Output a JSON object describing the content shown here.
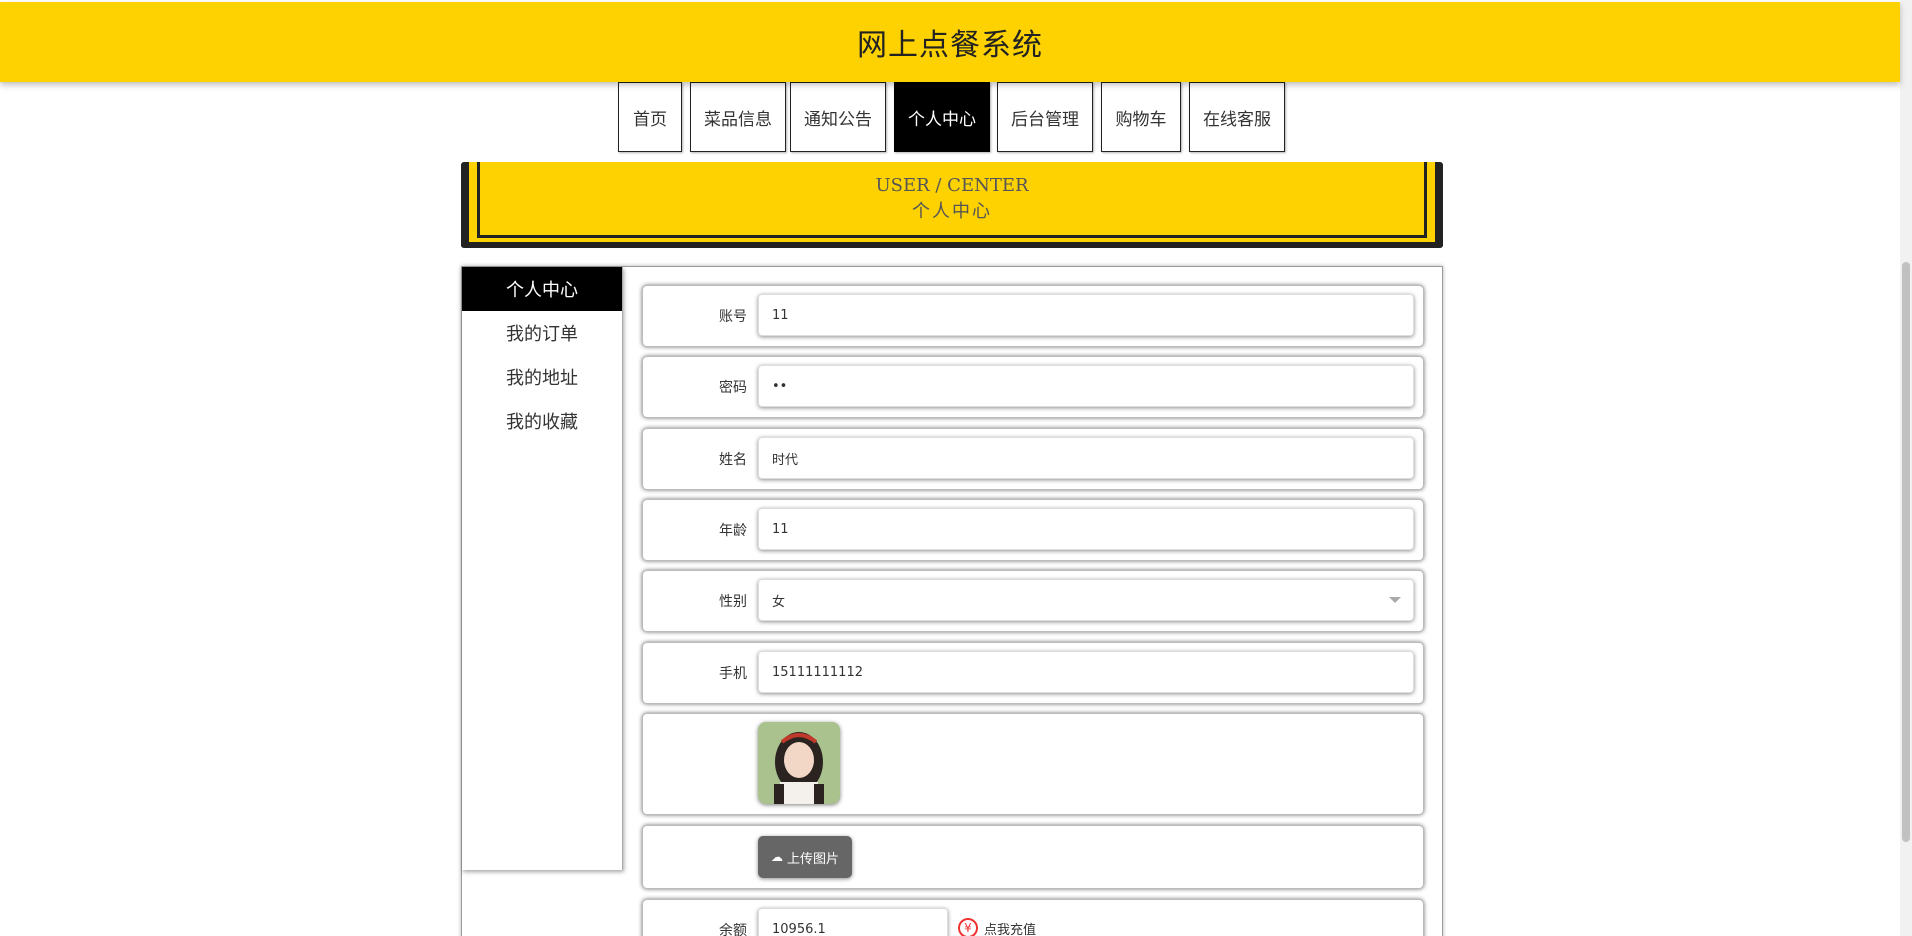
{
  "header": {
    "title": "网上点餐系统"
  },
  "nav": {
    "items": [
      {
        "label": "首页"
      },
      {
        "label": "菜品信息"
      },
      {
        "label": "通知公告"
      },
      {
        "label": "个人中心"
      },
      {
        "label": "后台管理"
      },
      {
        "label": "购物车"
      },
      {
        "label": "在线客服"
      }
    ],
    "active": "个人中心"
  },
  "banner": {
    "en": "USER / CENTER",
    "cn": "个人中心"
  },
  "sidebar": {
    "items": [
      {
        "label": "个人中心"
      },
      {
        "label": "我的订单"
      },
      {
        "label": "我的地址"
      },
      {
        "label": "我的收藏"
      }
    ],
    "active": "个人中心"
  },
  "form": {
    "account": {
      "label": "账号",
      "value": "11"
    },
    "password": {
      "label": "密码",
      "value": "••"
    },
    "name": {
      "label": "姓名",
      "value": "时代"
    },
    "age": {
      "label": "年龄",
      "value": "11"
    },
    "gender": {
      "label": "性别",
      "value": "女"
    },
    "phone": {
      "label": "手机",
      "value": "15111111112"
    },
    "upload_label": "上传图片",
    "balance": {
      "label": "余额",
      "value": "10956.1"
    },
    "recharge_label": "点我充值"
  },
  "colors": {
    "brand": "#fdd200",
    "active_bg": "#000000"
  }
}
